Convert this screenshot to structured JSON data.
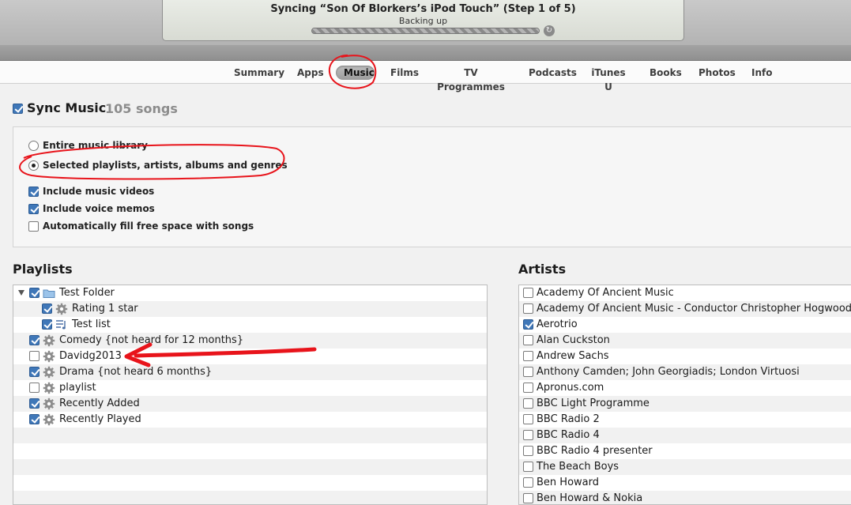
{
  "sync_status": {
    "title": "Syncing “Son Of Blorkers’s iPod Touch” (Step 1 of 5)",
    "subtitle": "Backing up",
    "progress": 1.0
  },
  "tabs": [
    {
      "label": "Summary",
      "active": false
    },
    {
      "label": "Apps",
      "active": false
    },
    {
      "label": "Music",
      "active": true
    },
    {
      "label": "Films",
      "active": false
    },
    {
      "label": "TV Programmes",
      "active": false
    },
    {
      "label": "Podcasts",
      "active": false
    },
    {
      "label": "iTunes U",
      "active": false
    },
    {
      "label": "Books",
      "active": false
    },
    {
      "label": "Photos",
      "active": false
    },
    {
      "label": "Info",
      "active": false
    }
  ],
  "sync_music": {
    "label": "Sync Music",
    "count": "105 songs",
    "checked": true
  },
  "options": {
    "radio_entire": {
      "label": "Entire music library",
      "checked": false
    },
    "radio_selected": {
      "label": "Selected playlists, artists, albums and genres",
      "checked": true
    },
    "include_videos": {
      "label": "Include music videos",
      "checked": true
    },
    "include_memos": {
      "label": "Include voice memos",
      "checked": true
    },
    "autofill": {
      "label": "Automatically fill free space with songs",
      "checked": false
    }
  },
  "playlists": {
    "title": "Playlists",
    "items": [
      {
        "label": "Test Folder",
        "checked": true,
        "icon": "folder-icon",
        "indent": 0,
        "expand": true
      },
      {
        "label": "Rating 1 star",
        "checked": true,
        "icon": "smart-playlist-gear-icon",
        "indent": 1
      },
      {
        "label": "Test list",
        "checked": true,
        "icon": "playlist-icon",
        "indent": 1
      },
      {
        "label": "Comedy {not heard for 12 months}",
        "checked": true,
        "icon": "smart-playlist-gear-icon",
        "indent": 0
      },
      {
        "label": "Davidg2013",
        "checked": false,
        "icon": "smart-playlist-gear-icon",
        "indent": 0
      },
      {
        "label": "Drama {not heard 6 months}",
        "checked": true,
        "icon": "smart-playlist-gear-icon",
        "indent": 0
      },
      {
        "label": "playlist",
        "checked": false,
        "icon": "smart-playlist-gear-icon",
        "indent": 0
      },
      {
        "label": "Recently Added",
        "checked": true,
        "icon": "smart-playlist-gear-icon",
        "indent": 0
      },
      {
        "label": "Recently Played",
        "checked": true,
        "icon": "smart-playlist-gear-icon",
        "indent": 0
      }
    ]
  },
  "artists": {
    "title": "Artists",
    "items": [
      {
        "label": "Academy Of Ancient Music",
        "checked": false
      },
      {
        "label": "Academy Of Ancient Music - Conductor Christopher Hogwood",
        "checked": false
      },
      {
        "label": "Aerotrio",
        "checked": true
      },
      {
        "label": "Alan Cuckston",
        "checked": false
      },
      {
        "label": "Andrew Sachs",
        "checked": false
      },
      {
        "label": "Anthony Camden; John Georgiadis; London Virtuosi",
        "checked": false
      },
      {
        "label": "Apronus.com",
        "checked": false
      },
      {
        "label": "BBC Light Programme",
        "checked": false
      },
      {
        "label": "BBC Radio 2",
        "checked": false
      },
      {
        "label": "BBC Radio 4",
        "checked": false
      },
      {
        "label": "BBC Radio 4 presenter",
        "checked": false
      },
      {
        "label": "The Beach Boys",
        "checked": false
      },
      {
        "label": "Ben Howard",
        "checked": false
      },
      {
        "label": "Ben Howard & Nokia",
        "checked": false
      }
    ]
  },
  "colors": {
    "annotation": "#e8141b",
    "checkbox": "#3f77b8"
  }
}
